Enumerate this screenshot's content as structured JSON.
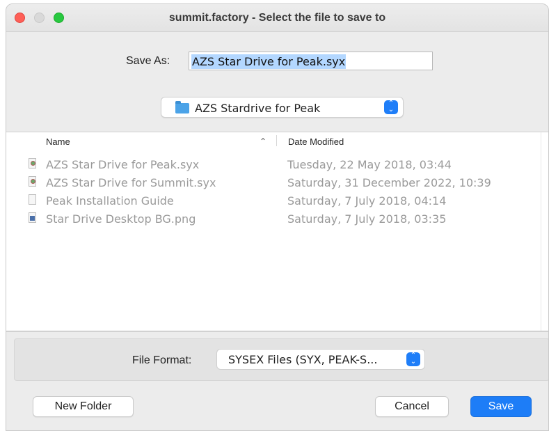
{
  "window": {
    "title": "summit.factory - Select the file to save to"
  },
  "save_as": {
    "label": "Save As:",
    "value": "AZS Star Drive for Peak.syx"
  },
  "location": {
    "folder": "AZS Stardrive for Peak",
    "icon": "folder-icon"
  },
  "file_list": {
    "columns": {
      "name": "Name",
      "date": "Date Modified"
    },
    "sort": "ascending",
    "rows": [
      {
        "name": "AZS Star Drive for Peak.syx",
        "date": "Tuesday, 22 May 2018, 03:44",
        "icon": "syx-file-icon"
      },
      {
        "name": "AZS Star Drive for Summit.syx",
        "date": "Saturday, 31 December 2022, 10:39",
        "icon": "syx-file-icon"
      },
      {
        "name": "Peak Installation Guide",
        "date": "Saturday, 7 July 2018, 04:14",
        "icon": "document-icon"
      },
      {
        "name": "Star Drive Desktop BG.png",
        "date": "Saturday, 7 July 2018, 03:35",
        "icon": "image-file-icon"
      }
    ]
  },
  "file_format": {
    "label": "File Format:",
    "value": "SYSEX Files (SYX, PEAK-S..."
  },
  "buttons": {
    "new_folder": "New Folder",
    "cancel": "Cancel",
    "save": "Save"
  },
  "colors": {
    "accent": "#1d7df7",
    "selection": "#b3d7ff"
  }
}
